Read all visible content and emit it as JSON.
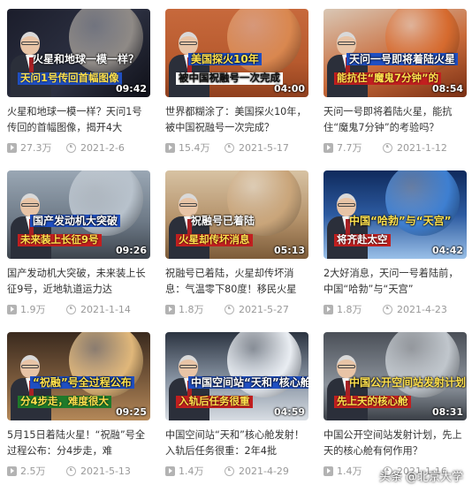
{
  "videos": [
    {
      "title": "火星和地球一模一样？天问1号传回的首幅图像，揭开4大",
      "views": "27.3万",
      "date": "2021-2-6",
      "duration": "09:42",
      "caption_a": "火星和地球一模一样？",
      "caption_b": "天问1号传回首幅图像",
      "theme": {
        "bg": "linear-gradient(135deg,#1b1d2b 0%,#2d3142 55%,#0f1018 100%)",
        "planet": "#8f8a86",
        "cap_a_color": "#ffffff",
        "cap_a_bg": "transparent",
        "cap_b_color": "#ffe14d",
        "cap_b_bg": "#1f4fc2"
      }
    },
    {
      "title": "世界都糊涂了：美国探火10年，被中国祝融号一次完成？",
      "views": "15.4万",
      "date": "2021-5-17",
      "duration": "04:00",
      "caption_a": "美国探火10年",
      "caption_b": "被中国祝融号一次完成",
      "theme": {
        "bg": "linear-gradient(180deg,#c7693c 0%,#b75a2e 60%,#8f3f1e 100%)",
        "planet": "#d9874f",
        "cap_a_color": "#ffe14d",
        "cap_a_bg": "#1f4fc2",
        "cap_b_color": "#111111",
        "cap_b_bg": "#ffffff"
      }
    },
    {
      "title": "天问一号即将着陆火星，能抗住“魔鬼7分钟”的考验吗？",
      "views": "7.7万",
      "date": "2021-1-12",
      "duration": "08:54",
      "caption_a": "天问一号即将着陆火星",
      "caption_b": "能抗住“魔鬼7分钟”的",
      "theme": {
        "bg": "linear-gradient(160deg,#d9c7b5 0%,#c96b3a 55%,#7a2f14 100%)",
        "planet": "#d66a2e",
        "cap_a_color": "#ffffff",
        "cap_a_bg": "#1f4fc2",
        "cap_b_color": "#ffe14d",
        "cap_b_bg": "#c21f1f"
      }
    },
    {
      "title": "国产发动机大突破，未来装上长征9号，近地轨道运力达",
      "views": "1.9万",
      "date": "2021-1-14",
      "duration": "09:26",
      "caption_a": "国产发动机大突破",
      "caption_b": "未来装上长征9号",
      "theme": {
        "bg": "linear-gradient(180deg,#9aa7b4 0%,#6b7784 60%,#3d444d 100%)",
        "planet": "#b8c2cc",
        "cap_a_color": "#ffffff",
        "cap_a_bg": "#1f4fc2",
        "cap_b_color": "#ffe14d",
        "cap_b_bg": "#c21f1f"
      }
    },
    {
      "title": "祝融号已着陆，火星却传坏消息：气温零下80度！移民火星",
      "views": "1.8万",
      "date": "2021-5-27",
      "duration": "05:13",
      "caption_a": "祝融号已着陆",
      "caption_b": "火星却传坏消息",
      "theme": {
        "bg": "linear-gradient(180deg,#d7c2a3 0%,#b5936b 55%,#7c5b39 100%)",
        "planet": "#c9a57a",
        "cap_a_color": "#ffffff",
        "cap_a_bg": "transparent",
        "cap_b_color": "#ffe14d",
        "cap_b_bg": "#c21f1f"
      }
    },
    {
      "title": "2大好消息，天问一号着陆前，中国“哈勃”与“天宫”",
      "views": "1.8万",
      "date": "2021-4-23",
      "duration": "04:42",
      "caption_a": "中国“哈勃”与“天宫”",
      "caption_b": "将齐赴太空",
      "theme": {
        "bg": "linear-gradient(180deg,#0f2a5c 0%,#2c5aa0 50%,#9ac0e8 100%)",
        "planet": "#3e7fd1",
        "cap_a_color": "#ffe14d",
        "cap_a_bg": "transparent",
        "cap_b_color": "#ffffff",
        "cap_b_bg": "#c21f1f"
      }
    },
    {
      "title": "5月15日着陆火星！“祝融”号全过程公布：分4步走，难",
      "views": "2.5万",
      "date": "2021-5-13",
      "duration": "09:25",
      "caption_a": "“祝融”号全过程公布",
      "caption_b": "分4步走，难度很大",
      "theme": {
        "bg": "linear-gradient(180deg,#3a2a1e 0%,#7a5a3c 55%,#b48858 100%)",
        "planet": "#e0b77a",
        "cap_a_color": "#ffe14d",
        "cap_a_bg": "#1f4fc2",
        "cap_b_color": "#ffe14d",
        "cap_b_bg": "#1f7a2a"
      }
    },
    {
      "title": "中国空间站“天和”核心舱发射！入轨后任务很重：2年4批",
      "views": "1.4万",
      "date": "2021-4-29",
      "duration": "04:59",
      "caption_a": "中国空间站“天和”核心舱发射",
      "caption_b": "入轨后任务很重",
      "theme": {
        "bg": "linear-gradient(180deg,#2b3340 0%,#8a96a5 55%,#d8dde3 100%)",
        "planet": "#e9edf2",
        "cap_a_color": "#ffffff",
        "cap_a_bg": "#1f4fc2",
        "cap_b_color": "#ffe14d",
        "cap_b_bg": "#c21f1f"
      }
    },
    {
      "title": "中国公开空间站发射计划，先上天的核心舱有何作用？",
      "views": "1.4万",
      "date": "2021-1-16",
      "duration": "08:31",
      "caption_a": "中国公开空间站发射计划",
      "caption_b": "先上天的核心舱",
      "theme": {
        "bg": "linear-gradient(180deg,#4a4f57 0%,#8c939c 60%,#3a3f46 100%)",
        "planet": "#c0c6cc",
        "cap_a_color": "#ffe14d",
        "cap_a_bg": "transparent",
        "cap_b_color": "#ffe14d",
        "cap_b_bg": "#c21f1f"
      }
    }
  ],
  "watermark": "头条 @北京大学"
}
